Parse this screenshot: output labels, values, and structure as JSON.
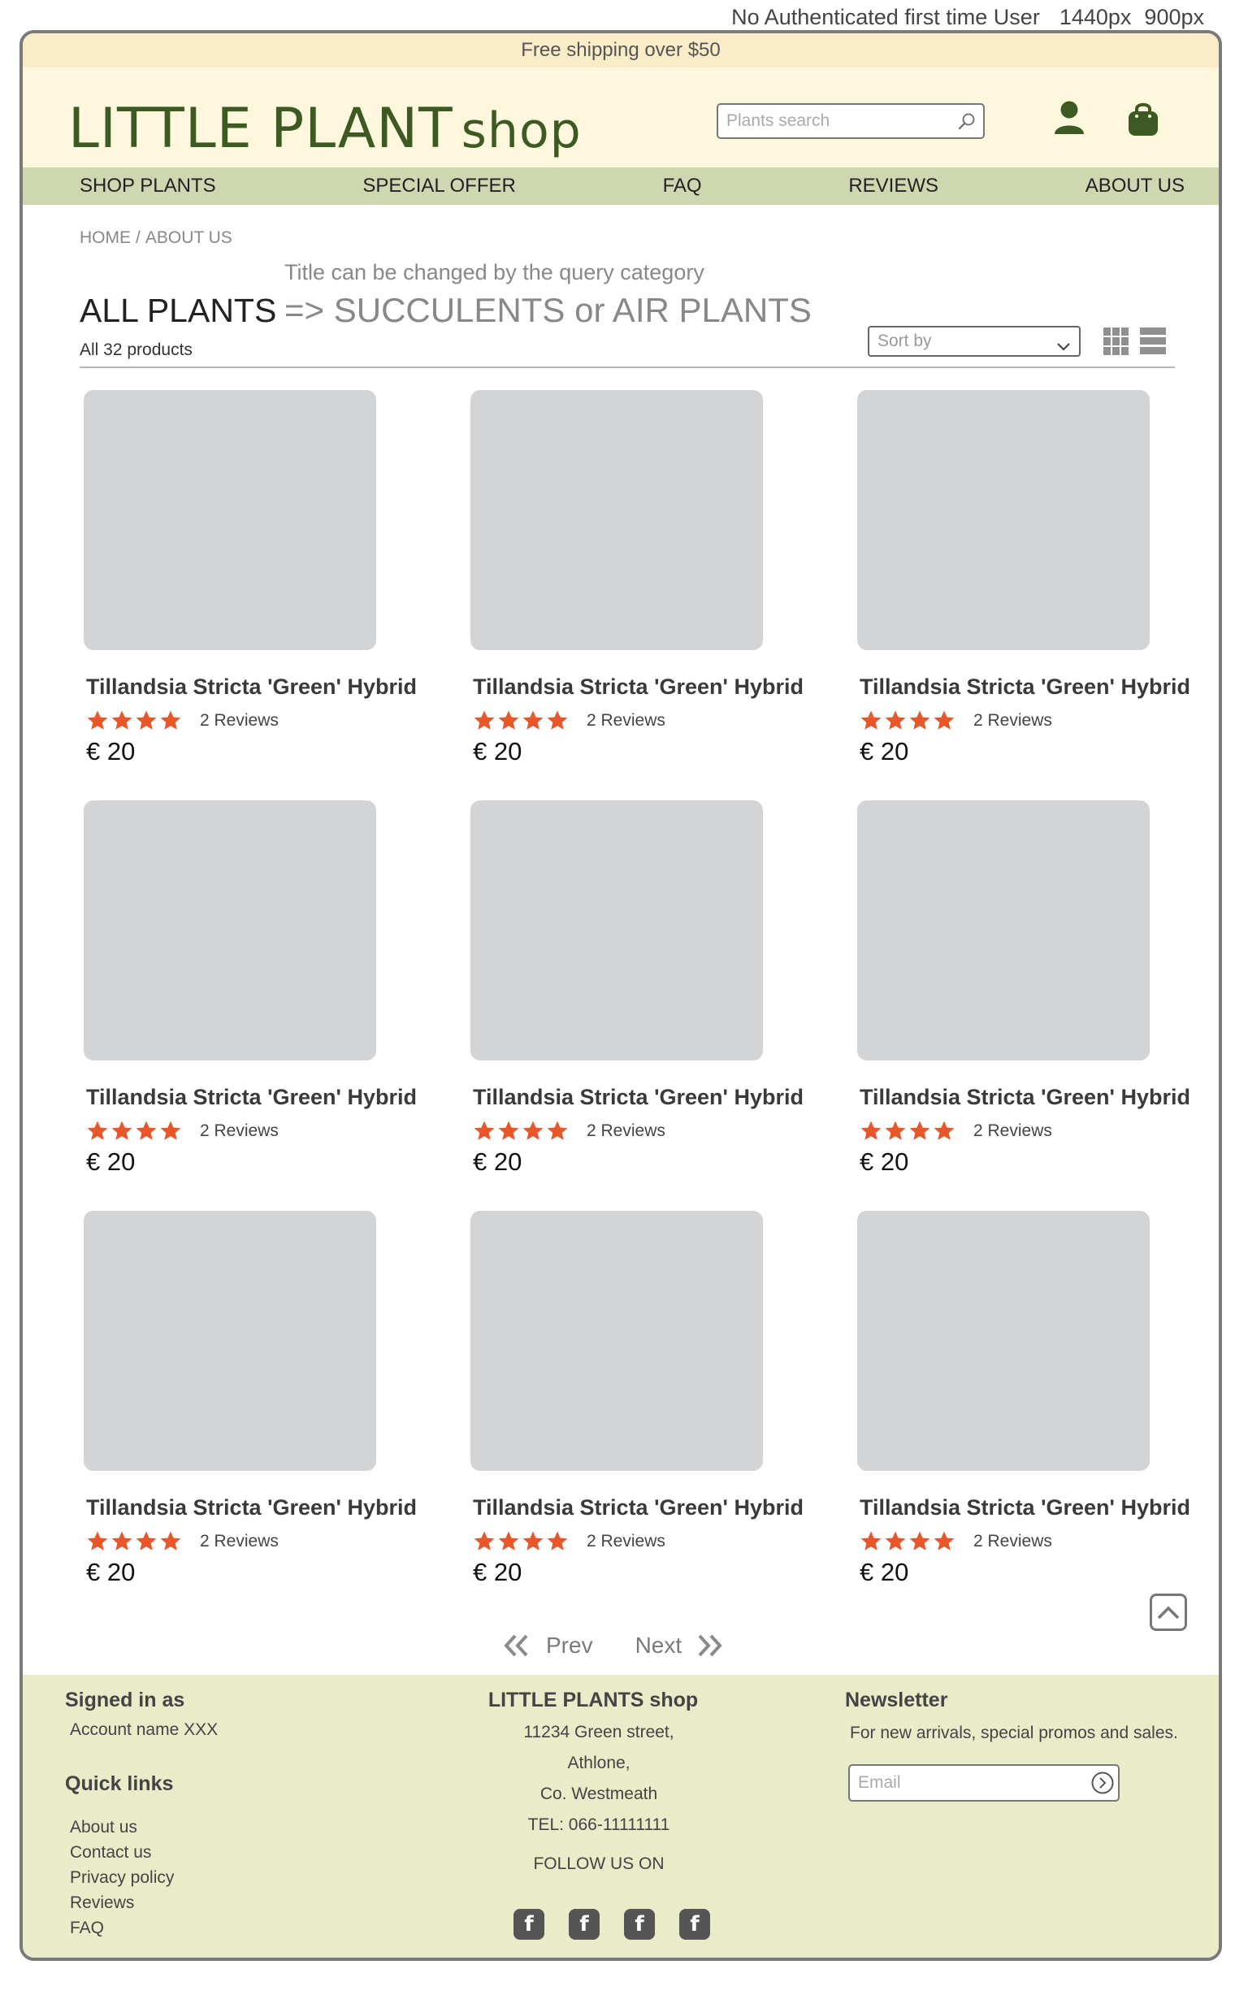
{
  "caption": {
    "user_state": "No Authenticated first time User",
    "width_label": "1440px",
    "height_label": "900px"
  },
  "banner": {
    "shipping": "Free shipping over $50"
  },
  "header": {
    "logo_main": "LITTLE PLANT",
    "logo_suffix": "shop",
    "search_placeholder": "Plants search",
    "icons": [
      "search-icon",
      "user-icon",
      "shopping-bag-icon"
    ],
    "brand_color": "#3d5a23"
  },
  "nav": {
    "items": [
      {
        "label": "SHOP PLANTS"
      },
      {
        "label": "SPECIAL OFFER"
      },
      {
        "label": "FAQ"
      },
      {
        "label": "REVIEWS"
      },
      {
        "label": "ABOUT US"
      }
    ]
  },
  "breadcrumb": {
    "home": "HOME",
    "separator": "/",
    "current": "ABOUT US"
  },
  "listing": {
    "title": "ALL PLANTS",
    "title_note": "Title can be changed by the query category",
    "title_alternative": "=> SUCCULENTS or AIR PLANTS",
    "product_count": "All 32 products",
    "sort_placeholder": "Sort by",
    "view_icons": [
      "grid-view-icon",
      "list-view-icon"
    ]
  },
  "products": [
    {
      "name": "Tillandsia Stricta 'Green' Hybrid",
      "rating": 4,
      "reviews": "2 Reviews",
      "price": "€ 20"
    },
    {
      "name": "Tillandsia Stricta 'Green' Hybrid",
      "rating": 4,
      "reviews": "2 Reviews",
      "price": "€ 20"
    },
    {
      "name": "Tillandsia Stricta 'Green' Hybrid",
      "rating": 4,
      "reviews": "2 Reviews",
      "price": "€ 20"
    },
    {
      "name": "Tillandsia Stricta 'Green' Hybrid",
      "rating": 4,
      "reviews": "2 Reviews",
      "price": "€ 20"
    },
    {
      "name": "Tillandsia Stricta 'Green' Hybrid",
      "rating": 4,
      "reviews": "2 Reviews",
      "price": "€ 20"
    },
    {
      "name": "Tillandsia Stricta 'Green' Hybrid",
      "rating": 4,
      "reviews": "2 Reviews",
      "price": "€ 20"
    },
    {
      "name": "Tillandsia Stricta 'Green' Hybrid",
      "rating": 4,
      "reviews": "2 Reviews",
      "price": "€ 20"
    },
    {
      "name": "Tillandsia Stricta 'Green' Hybrid",
      "rating": 4,
      "reviews": "2 Reviews",
      "price": "€ 20"
    },
    {
      "name": "Tillandsia Stricta 'Green' Hybrid",
      "rating": 4,
      "reviews": "2 Reviews",
      "price": "€ 20"
    }
  ],
  "star_color": "#e8572a",
  "pagination": {
    "prev": "Prev",
    "next": "Next"
  },
  "footer": {
    "signed_in_heading": "Signed in as",
    "account_name": "Account name XXX",
    "quick_links_heading": "Quick links",
    "quick_links": [
      "About us",
      "Contact us",
      "Privacy policy",
      "Reviews",
      "FAQ"
    ],
    "shop_name": "LITTLE PLANTS shop",
    "address": [
      "11234 Green street,",
      "Athlone,",
      "Co. Westmeath",
      "TEL: 066-11111111"
    ],
    "follow_label": "FOLLOW US ON",
    "social_icons": [
      "facebook-icon",
      "facebook-icon",
      "facebook-icon",
      "facebook-icon"
    ],
    "social_glyph": "f",
    "newsletter_heading": "Newsletter",
    "newsletter_text": "For new arrivals, special promos and sales.",
    "email_placeholder": "Email"
  },
  "colors": {
    "banner": "#f9ecc6",
    "header": "#fdf8dd",
    "nav": "#cfd7b1",
    "footer": "#e9ebc9",
    "image_placeholder": "#d3d4d5"
  }
}
